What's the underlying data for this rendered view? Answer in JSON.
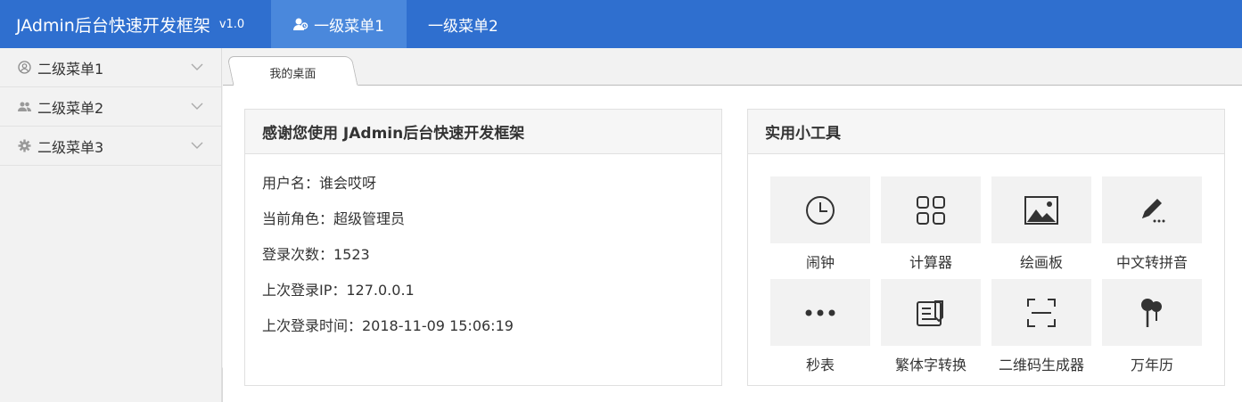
{
  "header": {
    "logo": "JAdmin后台快速开发框架",
    "version": "v1.0",
    "menus": [
      {
        "label": "一级菜单1",
        "active": true
      },
      {
        "label": "一级菜单2",
        "active": false
      }
    ]
  },
  "sidebar": {
    "items": [
      {
        "label": "二级菜单1",
        "icon": "user-circle-icon"
      },
      {
        "label": "二级菜单2",
        "icon": "users-icon"
      },
      {
        "label": "二级菜单3",
        "icon": "gear-icon"
      }
    ]
  },
  "tabs": [
    {
      "label": "我的桌面",
      "active": true
    }
  ],
  "welcome": {
    "title": "感谢您使用 JAdmin后台快速开发框架",
    "lines": [
      "用户名：谁会哎呀",
      "当前角色：超级管理员",
      "登录次数：1523",
      "上次登录IP：127.0.0.1",
      "上次登录时间：2018-11-09 15:06:19"
    ]
  },
  "tools": {
    "title": "实用小工具",
    "items": [
      {
        "label": "闹钟",
        "icon": "clock-icon"
      },
      {
        "label": "计算器",
        "icon": "grid-apps-icon"
      },
      {
        "label": "绘画板",
        "icon": "picture-icon"
      },
      {
        "label": "中文转拼音",
        "icon": "pencil-icon"
      },
      {
        "label": "秒表",
        "icon": "more-dots-icon"
      },
      {
        "label": "繁体字转换",
        "icon": "edit-document-icon"
      },
      {
        "label": "二维码生成器",
        "icon": "scan-icon"
      },
      {
        "label": "万年历",
        "icon": "balloon-pins-icon"
      }
    ]
  },
  "colors": {
    "header_bg": "#2f6fcf",
    "header_active": "#4a88dc"
  }
}
